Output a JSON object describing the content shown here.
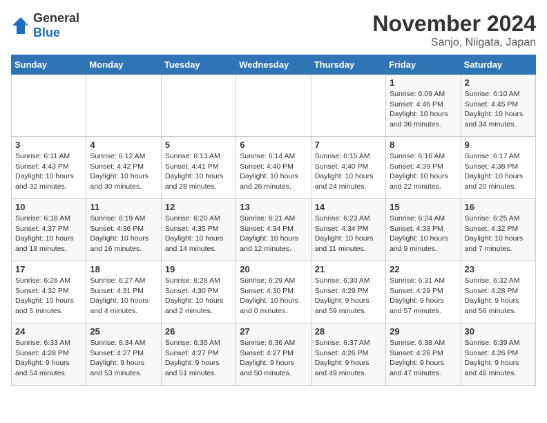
{
  "logo": {
    "general": "General",
    "blue": "Blue"
  },
  "title": "November 2024",
  "location": "Sanjo, Niigata, Japan",
  "days_header": [
    "Sunday",
    "Monday",
    "Tuesday",
    "Wednesday",
    "Thursday",
    "Friday",
    "Saturday"
  ],
  "weeks": [
    [
      {
        "day": "",
        "info": ""
      },
      {
        "day": "",
        "info": ""
      },
      {
        "day": "",
        "info": ""
      },
      {
        "day": "",
        "info": ""
      },
      {
        "day": "",
        "info": ""
      },
      {
        "day": "1",
        "info": "Sunrise: 6:09 AM\nSunset: 4:46 PM\nDaylight: 10 hours\nand 36 minutes."
      },
      {
        "day": "2",
        "info": "Sunrise: 6:10 AM\nSunset: 4:45 PM\nDaylight: 10 hours\nand 34 minutes."
      }
    ],
    [
      {
        "day": "3",
        "info": "Sunrise: 6:11 AM\nSunset: 4:43 PM\nDaylight: 10 hours\nand 32 minutes."
      },
      {
        "day": "4",
        "info": "Sunrise: 6:12 AM\nSunset: 4:42 PM\nDaylight: 10 hours\nand 30 minutes."
      },
      {
        "day": "5",
        "info": "Sunrise: 6:13 AM\nSunset: 4:41 PM\nDaylight: 10 hours\nand 28 minutes."
      },
      {
        "day": "6",
        "info": "Sunrise: 6:14 AM\nSunset: 4:40 PM\nDaylight: 10 hours\nand 26 minutes."
      },
      {
        "day": "7",
        "info": "Sunrise: 6:15 AM\nSunset: 4:40 PM\nDaylight: 10 hours\nand 24 minutes."
      },
      {
        "day": "8",
        "info": "Sunrise: 6:16 AM\nSunset: 4:39 PM\nDaylight: 10 hours\nand 22 minutes."
      },
      {
        "day": "9",
        "info": "Sunrise: 6:17 AM\nSunset: 4:38 PM\nDaylight: 10 hours\nand 20 minutes."
      }
    ],
    [
      {
        "day": "10",
        "info": "Sunrise: 6:18 AM\nSunset: 4:37 PM\nDaylight: 10 hours\nand 18 minutes."
      },
      {
        "day": "11",
        "info": "Sunrise: 6:19 AM\nSunset: 4:36 PM\nDaylight: 10 hours\nand 16 minutes."
      },
      {
        "day": "12",
        "info": "Sunrise: 6:20 AM\nSunset: 4:35 PM\nDaylight: 10 hours\nand 14 minutes."
      },
      {
        "day": "13",
        "info": "Sunrise: 6:21 AM\nSunset: 4:34 PM\nDaylight: 10 hours\nand 12 minutes."
      },
      {
        "day": "14",
        "info": "Sunrise: 6:23 AM\nSunset: 4:34 PM\nDaylight: 10 hours\nand 11 minutes."
      },
      {
        "day": "15",
        "info": "Sunrise: 6:24 AM\nSunset: 4:33 PM\nDaylight: 10 hours\nand 9 minutes."
      },
      {
        "day": "16",
        "info": "Sunrise: 6:25 AM\nSunset: 4:32 PM\nDaylight: 10 hours\nand 7 minutes."
      }
    ],
    [
      {
        "day": "17",
        "info": "Sunrise: 6:26 AM\nSunset: 4:32 PM\nDaylight: 10 hours\nand 5 minutes."
      },
      {
        "day": "18",
        "info": "Sunrise: 6:27 AM\nSunset: 4:31 PM\nDaylight: 10 hours\nand 4 minutes."
      },
      {
        "day": "19",
        "info": "Sunrise: 6:28 AM\nSunset: 4:30 PM\nDaylight: 10 hours\nand 2 minutes."
      },
      {
        "day": "20",
        "info": "Sunrise: 6:29 AM\nSunset: 4:30 PM\nDaylight: 10 hours\nand 0 minutes."
      },
      {
        "day": "21",
        "info": "Sunrise: 6:30 AM\nSunset: 4:29 PM\nDaylight: 9 hours\nand 59 minutes."
      },
      {
        "day": "22",
        "info": "Sunrise: 6:31 AM\nSunset: 4:29 PM\nDaylight: 9 hours\nand 57 minutes."
      },
      {
        "day": "23",
        "info": "Sunrise: 6:32 AM\nSunset: 4:28 PM\nDaylight: 9 hours\nand 56 minutes."
      }
    ],
    [
      {
        "day": "24",
        "info": "Sunrise: 6:33 AM\nSunset: 4:28 PM\nDaylight: 9 hours\nand 54 minutes."
      },
      {
        "day": "25",
        "info": "Sunrise: 6:34 AM\nSunset: 4:27 PM\nDaylight: 9 hours\nand 53 minutes."
      },
      {
        "day": "26",
        "info": "Sunrise: 6:35 AM\nSunset: 4:27 PM\nDaylight: 9 hours\nand 51 minutes."
      },
      {
        "day": "27",
        "info": "Sunrise: 6:36 AM\nSunset: 4:27 PM\nDaylight: 9 hours\nand 50 minutes."
      },
      {
        "day": "28",
        "info": "Sunrise: 6:37 AM\nSunset: 4:26 PM\nDaylight: 9 hours\nand 49 minutes."
      },
      {
        "day": "29",
        "info": "Sunrise: 6:38 AM\nSunset: 4:26 PM\nDaylight: 9 hours\nand 47 minutes."
      },
      {
        "day": "30",
        "info": "Sunrise: 6:39 AM\nSunset: 4:26 PM\nDaylight: 9 hours\nand 46 minutes."
      }
    ]
  ]
}
